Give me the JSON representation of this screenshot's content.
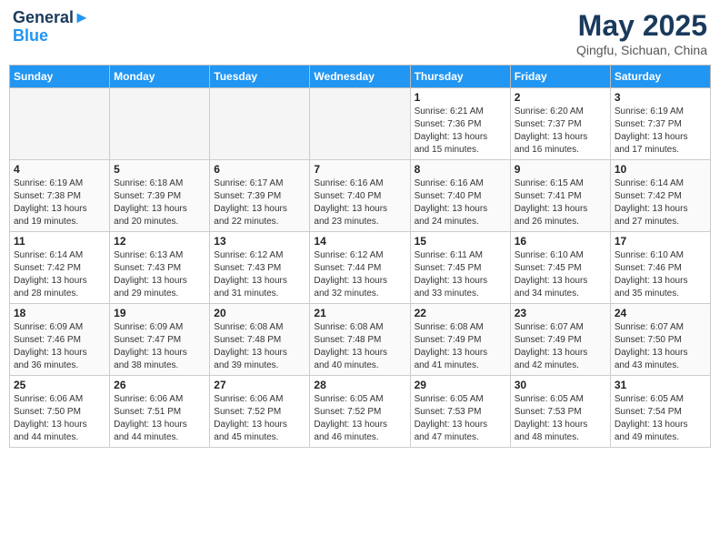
{
  "header": {
    "logo_line1": "General",
    "logo_line2": "Blue",
    "month_year": "May 2025",
    "location": "Qingfu, Sichuan, China"
  },
  "days_of_week": [
    "Sunday",
    "Monday",
    "Tuesday",
    "Wednesday",
    "Thursday",
    "Friday",
    "Saturday"
  ],
  "weeks": [
    [
      {
        "day": "",
        "info": ""
      },
      {
        "day": "",
        "info": ""
      },
      {
        "day": "",
        "info": ""
      },
      {
        "day": "",
        "info": ""
      },
      {
        "day": "1",
        "info": "Sunrise: 6:21 AM\nSunset: 7:36 PM\nDaylight: 13 hours\nand 15 minutes."
      },
      {
        "day": "2",
        "info": "Sunrise: 6:20 AM\nSunset: 7:37 PM\nDaylight: 13 hours\nand 16 minutes."
      },
      {
        "day": "3",
        "info": "Sunrise: 6:19 AM\nSunset: 7:37 PM\nDaylight: 13 hours\nand 17 minutes."
      }
    ],
    [
      {
        "day": "4",
        "info": "Sunrise: 6:19 AM\nSunset: 7:38 PM\nDaylight: 13 hours\nand 19 minutes."
      },
      {
        "day": "5",
        "info": "Sunrise: 6:18 AM\nSunset: 7:39 PM\nDaylight: 13 hours\nand 20 minutes."
      },
      {
        "day": "6",
        "info": "Sunrise: 6:17 AM\nSunset: 7:39 PM\nDaylight: 13 hours\nand 22 minutes."
      },
      {
        "day": "7",
        "info": "Sunrise: 6:16 AM\nSunset: 7:40 PM\nDaylight: 13 hours\nand 23 minutes."
      },
      {
        "day": "8",
        "info": "Sunrise: 6:16 AM\nSunset: 7:40 PM\nDaylight: 13 hours\nand 24 minutes."
      },
      {
        "day": "9",
        "info": "Sunrise: 6:15 AM\nSunset: 7:41 PM\nDaylight: 13 hours\nand 26 minutes."
      },
      {
        "day": "10",
        "info": "Sunrise: 6:14 AM\nSunset: 7:42 PM\nDaylight: 13 hours\nand 27 minutes."
      }
    ],
    [
      {
        "day": "11",
        "info": "Sunrise: 6:14 AM\nSunset: 7:42 PM\nDaylight: 13 hours\nand 28 minutes."
      },
      {
        "day": "12",
        "info": "Sunrise: 6:13 AM\nSunset: 7:43 PM\nDaylight: 13 hours\nand 29 minutes."
      },
      {
        "day": "13",
        "info": "Sunrise: 6:12 AM\nSunset: 7:43 PM\nDaylight: 13 hours\nand 31 minutes."
      },
      {
        "day": "14",
        "info": "Sunrise: 6:12 AM\nSunset: 7:44 PM\nDaylight: 13 hours\nand 32 minutes."
      },
      {
        "day": "15",
        "info": "Sunrise: 6:11 AM\nSunset: 7:45 PM\nDaylight: 13 hours\nand 33 minutes."
      },
      {
        "day": "16",
        "info": "Sunrise: 6:10 AM\nSunset: 7:45 PM\nDaylight: 13 hours\nand 34 minutes."
      },
      {
        "day": "17",
        "info": "Sunrise: 6:10 AM\nSunset: 7:46 PM\nDaylight: 13 hours\nand 35 minutes."
      }
    ],
    [
      {
        "day": "18",
        "info": "Sunrise: 6:09 AM\nSunset: 7:46 PM\nDaylight: 13 hours\nand 36 minutes."
      },
      {
        "day": "19",
        "info": "Sunrise: 6:09 AM\nSunset: 7:47 PM\nDaylight: 13 hours\nand 38 minutes."
      },
      {
        "day": "20",
        "info": "Sunrise: 6:08 AM\nSunset: 7:48 PM\nDaylight: 13 hours\nand 39 minutes."
      },
      {
        "day": "21",
        "info": "Sunrise: 6:08 AM\nSunset: 7:48 PM\nDaylight: 13 hours\nand 40 minutes."
      },
      {
        "day": "22",
        "info": "Sunrise: 6:08 AM\nSunset: 7:49 PM\nDaylight: 13 hours\nand 41 minutes."
      },
      {
        "day": "23",
        "info": "Sunrise: 6:07 AM\nSunset: 7:49 PM\nDaylight: 13 hours\nand 42 minutes."
      },
      {
        "day": "24",
        "info": "Sunrise: 6:07 AM\nSunset: 7:50 PM\nDaylight: 13 hours\nand 43 minutes."
      }
    ],
    [
      {
        "day": "25",
        "info": "Sunrise: 6:06 AM\nSunset: 7:50 PM\nDaylight: 13 hours\nand 44 minutes."
      },
      {
        "day": "26",
        "info": "Sunrise: 6:06 AM\nSunset: 7:51 PM\nDaylight: 13 hours\nand 44 minutes."
      },
      {
        "day": "27",
        "info": "Sunrise: 6:06 AM\nSunset: 7:52 PM\nDaylight: 13 hours\nand 45 minutes."
      },
      {
        "day": "28",
        "info": "Sunrise: 6:05 AM\nSunset: 7:52 PM\nDaylight: 13 hours\nand 46 minutes."
      },
      {
        "day": "29",
        "info": "Sunrise: 6:05 AM\nSunset: 7:53 PM\nDaylight: 13 hours\nand 47 minutes."
      },
      {
        "day": "30",
        "info": "Sunrise: 6:05 AM\nSunset: 7:53 PM\nDaylight: 13 hours\nand 48 minutes."
      },
      {
        "day": "31",
        "info": "Sunrise: 6:05 AM\nSunset: 7:54 PM\nDaylight: 13 hours\nand 49 minutes."
      }
    ]
  ]
}
